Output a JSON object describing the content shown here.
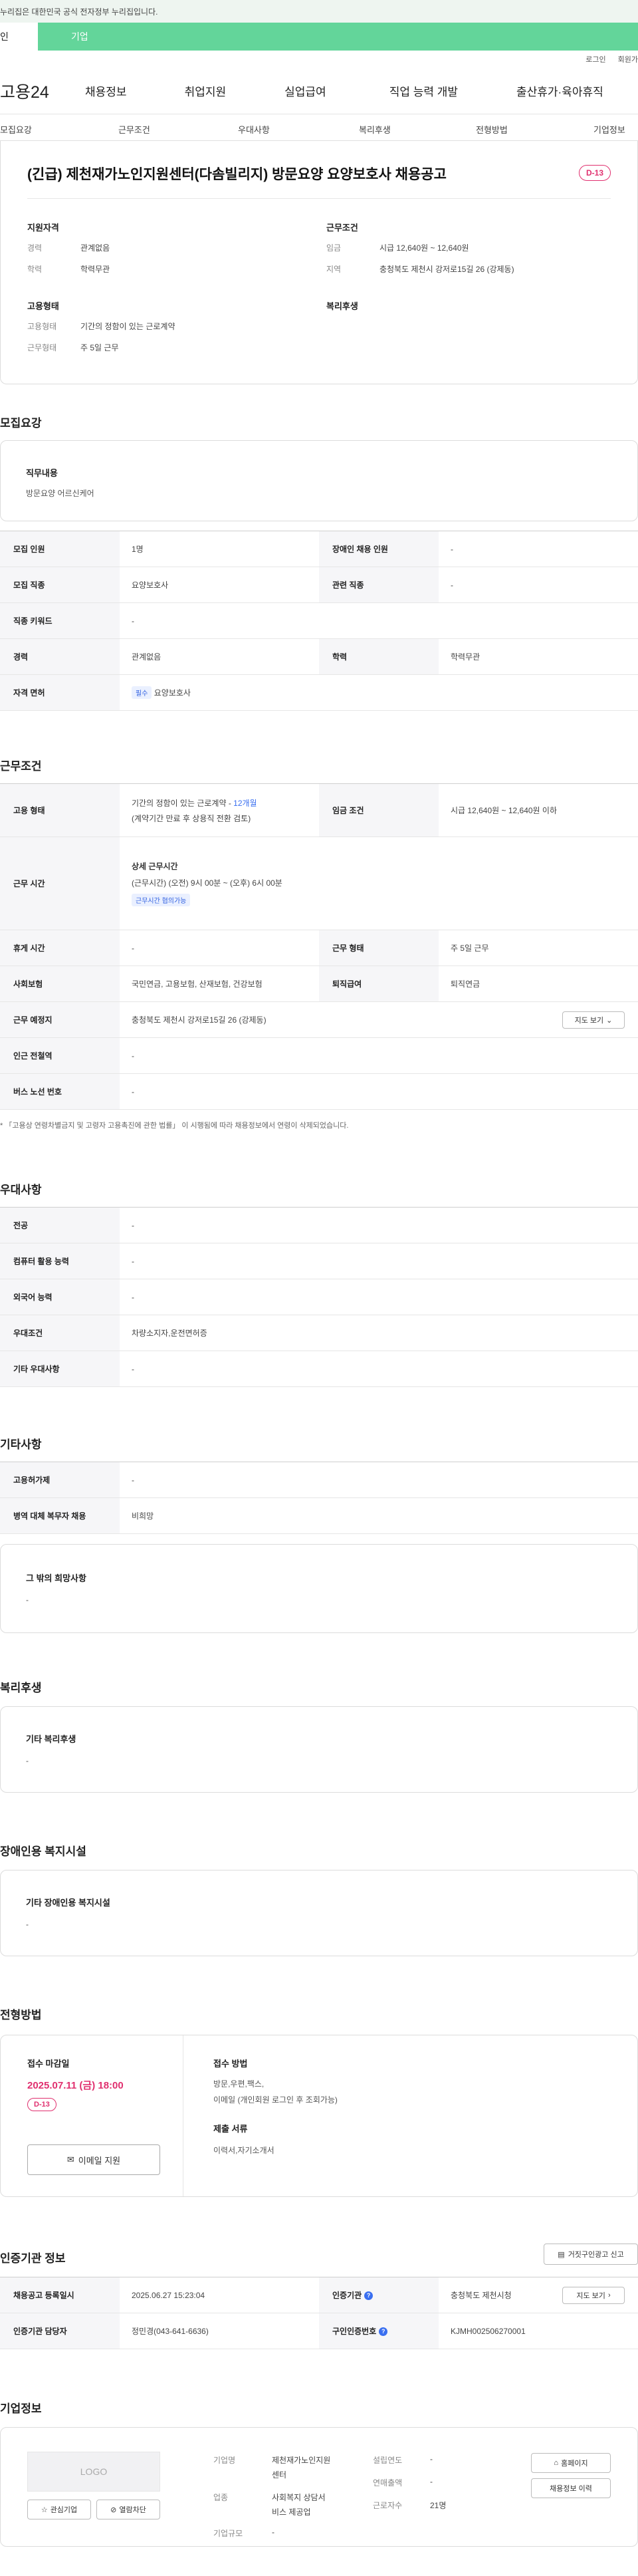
{
  "gov_banner": "누리집은 대한민국 공식 전자정부 누리집입니다.",
  "gov_tabs": [
    "인",
    "기업"
  ],
  "util": {
    "login": "로그인",
    "join": "회원가"
  },
  "logo": "고용24",
  "gnb": [
    "채용정보",
    "취업지원",
    "실업급여",
    "직업 능력 개발",
    "출산휴가·육아휴직"
  ],
  "subnav": [
    "모집요강",
    "근무조건",
    "우대사항",
    "복리후생",
    "전형방법",
    "기업정보"
  ],
  "job": {
    "title": "(긴급) 제천재가노인지원센터(다솜빌리지) 방문요양 요양보호사 채용공고",
    "dday": "D-13",
    "qual_title": "지원자격",
    "qual": [
      {
        "k": "경력",
        "v": "관계없음"
      },
      {
        "k": "학력",
        "v": "학력무관"
      }
    ],
    "cond_title": "근무조건",
    "cond": [
      {
        "k": "임금",
        "v": "시급 12,640원 ~ 12,640원"
      },
      {
        "k": "지역",
        "v": "충청북도 제천시 강저로15길 26 (강제동)"
      }
    ],
    "emp_title": "고용형태",
    "emp": [
      {
        "k": "고용형태",
        "v": "기간의 정함이 있는 근로계약"
      },
      {
        "k": "근무형태",
        "v": "주 5일 근무"
      }
    ],
    "welfare_title": "복리후생"
  },
  "recruit": {
    "title": "모집요강",
    "duty_label": "직무내용",
    "duty_value": "방문요양 어르신케어",
    "rows": {
      "r1": {
        "h1": "모집 인원",
        "v1": "1명",
        "h2": "장애인 채용 인원",
        "v2": "-"
      },
      "r2": {
        "h1": "모집 직종",
        "v1": "요양보호사",
        "h2": "관련 직종",
        "v2": "-"
      },
      "r3": {
        "h1": "직종 키워드",
        "v1": "-"
      },
      "r4": {
        "h1": "경력",
        "v1": "관계없음",
        "h2": "학력",
        "v2": "학력무관"
      },
      "r5": {
        "h1": "자격 면허",
        "tag": "필수",
        "v1": "요양보호사"
      }
    }
  },
  "work": {
    "title": "근무조건",
    "emp_h": "고용 형태",
    "emp_v": "기간의 정함이 있는 근로계약 - ",
    "emp_period": "12개월",
    "emp_sub": "(계약기간 만료 후 상용직 전환 검토)",
    "wage_h": "임금 조건",
    "wage_v": "시급 12,640원 ~ 12,640원 이하",
    "time_h": "근무 시간",
    "time_label": "상세 근무시간",
    "time_v": "(근무시간) (오전) 9시 00분 ~ (오후) 6시 00분",
    "time_tag": "근무시간 협의가능",
    "rest_h": "휴게 시간",
    "rest_v": "-",
    "type_h": "근무 형태",
    "type_v": "주 5일 근무",
    "ins_h": "사회보험",
    "ins_v": "국민연금, 고용보험, 산재보험, 건강보험",
    "ret_h": "퇴직급여",
    "ret_v": "퇴직연금",
    "loc_h": "근무 예정지",
    "loc_v": "충청북도 제천시 강저로15길 26 (강제동)",
    "map_btn": "지도 보기",
    "sub_h": "인근 전철역",
    "sub_v": "-",
    "bus_h": "버스 노선 번호",
    "bus_v": "-",
    "note": "* 「고용상 연령차별금지 및 고령자 고용촉진에 관한 법률」 이 시행됨에 따라 채용정보에서 연령이 삭제되었습니다."
  },
  "pref": {
    "title": "우대사항",
    "rows": [
      {
        "h": "전공",
        "v": "-"
      },
      {
        "h": "컴퓨터 활용 능력",
        "v": "-"
      },
      {
        "h": "외국어 능력",
        "v": "-"
      },
      {
        "h": "우대조건",
        "v": "차량소지자,운전면허증"
      },
      {
        "h": "기타 우대사항",
        "v": "-"
      }
    ]
  },
  "etc": {
    "title": "기타사항",
    "rows": [
      {
        "h": "고용허가제",
        "v": "-"
      },
      {
        "h": "병역 대체 복무자 채용",
        "v": "비희망"
      }
    ],
    "wish_label": "그 밖의 희망사항",
    "wish_value": "-"
  },
  "benefit": {
    "title": "복리후생",
    "label": "기타 복리후생",
    "value": "-"
  },
  "disabled": {
    "title": "장애인용 복지시설",
    "label": "기타 장애인용 복지시설",
    "value": "-"
  },
  "selection": {
    "title": "전형방법",
    "deadline_label": "접수 마감일",
    "deadline": "2025.07.11 (금) 18:00",
    "dday": "D-13",
    "apply_btn": "이메일 지원",
    "method_label": "접수 방법",
    "method_v1": "방문,우편,팩스,",
    "method_v2": "이메일 (개인회원 로그인 후 조회가능)",
    "docs_label": "제출 서류",
    "docs_v": "이력서,자기소개서"
  },
  "cert": {
    "title": "인증기관 정보",
    "report_btn": "거짓구인광고 신고",
    "r1": {
      "h1": "채용공고 등록일시",
      "v1": "2025.06.27 15:23:04",
      "h2": "인증기관",
      "v2": "충청북도 제천시청",
      "btn": "지도 보기"
    },
    "r2": {
      "h1": "인증기관 담당자",
      "v1": "정민경(043-641-6636)",
      "h2": "구인인증번호",
      "v2": "KJMH002506270001"
    }
  },
  "company": {
    "title": "기업정보",
    "logo": "LOGO",
    "fav_btn": "관심기업",
    "block_btn": "열람차단",
    "name_k": "기업명",
    "name_v1": "제천재가노인지원",
    "name_v2": "센터",
    "ind_k": "업종",
    "ind_v1": "사회복지 상담서",
    "ind_v2": "비스 제공업",
    "size_k": "기업규모",
    "size_v": "-",
    "est_k": "설립연도",
    "est_v": "-",
    "rev_k": "연매출액",
    "rev_v": "-",
    "emp_k": "근로자수",
    "emp_v": "21명",
    "home_btn": "홈페이지",
    "jobs_btn": "채용정보 이력"
  }
}
